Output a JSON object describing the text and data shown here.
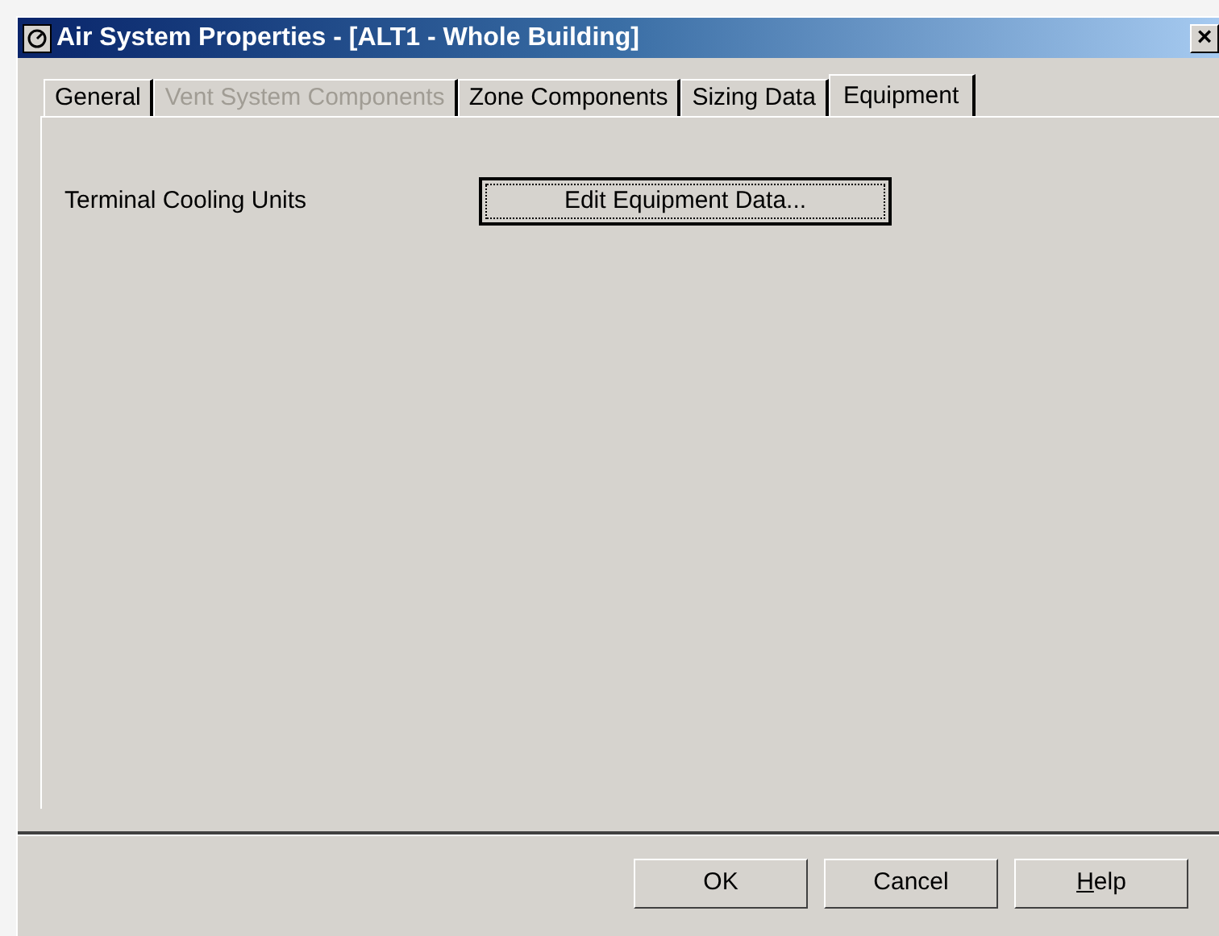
{
  "window": {
    "title": "Air System Properties - [ALT1 - Whole Building]",
    "close_label": "×"
  },
  "tabs": [
    {
      "label": "General",
      "selected": false,
      "disabled": false
    },
    {
      "label": "Vent System Components",
      "selected": false,
      "disabled": true
    },
    {
      "label": "Zone Components",
      "selected": false,
      "disabled": false
    },
    {
      "label": "Sizing Data",
      "selected": false,
      "disabled": false
    },
    {
      "label": "Equipment",
      "selected": true,
      "disabled": false
    }
  ],
  "panel": {
    "label": "Terminal Cooling Units",
    "button": "Edit Equipment Data..."
  },
  "buttons": [
    {
      "label": "OK",
      "first_letter_underlined": false
    },
    {
      "label": "Cancel",
      "first_letter_underlined": false
    },
    {
      "label": "Help",
      "first_letter_underlined": true
    }
  ]
}
